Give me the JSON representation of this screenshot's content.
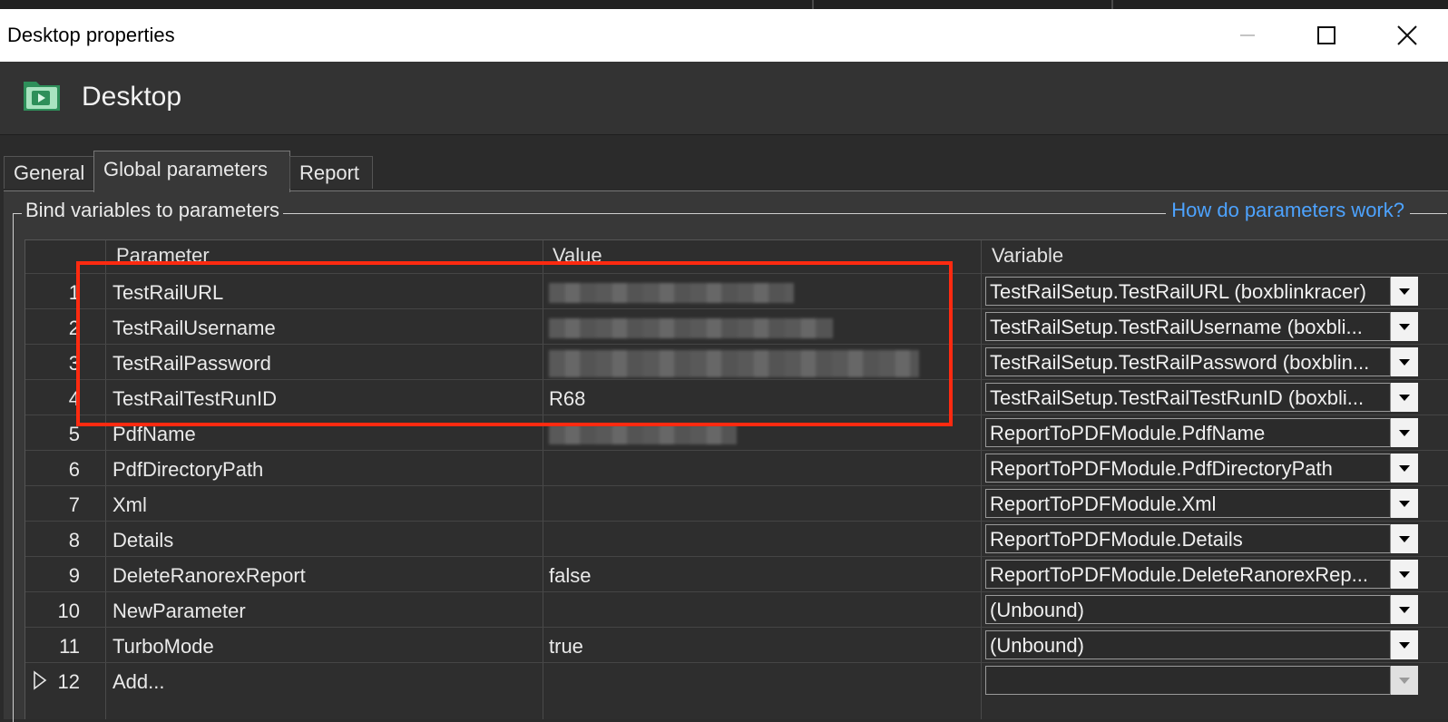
{
  "window": {
    "title": "Desktop properties",
    "heading": "Desktop",
    "icon": "desktop-folder-icon"
  },
  "tabs": [
    {
      "label": "General"
    },
    {
      "label": "Global parameters",
      "active": true
    },
    {
      "label": "Report"
    }
  ],
  "section": {
    "legend": "Bind variables to parameters",
    "help_link": "How do parameters work?"
  },
  "table": {
    "columns": [
      "Parameter",
      "Value",
      "Variable"
    ],
    "rows": [
      {
        "num": "1",
        "parameter": "TestRailURL",
        "value": "",
        "variable": "TestRailSetup.TestRailURL (boxblinkracer)"
      },
      {
        "num": "2",
        "parameter": "TestRailUsername",
        "value": "",
        "variable": "TestRailSetup.TestRailUsername (boxbli..."
      },
      {
        "num": "3",
        "parameter": "TestRailPassword",
        "value": "",
        "variable": "TestRailSetup.TestRailPassword (boxblin..."
      },
      {
        "num": "4",
        "parameter": "TestRailTestRunID",
        "value": "R68",
        "variable": "TestRailSetup.TestRailTestRunID (boxbli..."
      },
      {
        "num": "5",
        "parameter": "PdfName",
        "value": "",
        "variable": "ReportToPDFModule.PdfName"
      },
      {
        "num": "6",
        "parameter": "PdfDirectoryPath",
        "value": "",
        "variable": "ReportToPDFModule.PdfDirectoryPath"
      },
      {
        "num": "7",
        "parameter": "Xml",
        "value": "",
        "variable": "ReportToPDFModule.Xml"
      },
      {
        "num": "8",
        "parameter": "Details",
        "value": "",
        "variable": "ReportToPDFModule.Details"
      },
      {
        "num": "9",
        "parameter": "DeleteRanorexReport",
        "value": "false",
        "variable": "ReportToPDFModule.DeleteRanorexRep..."
      },
      {
        "num": "10",
        "parameter": "NewParameter",
        "value": "",
        "variable": "(Unbound)"
      },
      {
        "num": "11",
        "parameter": "TurboMode",
        "value": "true",
        "variable": "(Unbound)"
      },
      {
        "num": "12",
        "parameter": "Add...",
        "value": "",
        "variable": ""
      }
    ]
  },
  "colors": {
    "link": "#4da3ff",
    "highlight_box": "#ff2a10",
    "background": "#383838"
  }
}
